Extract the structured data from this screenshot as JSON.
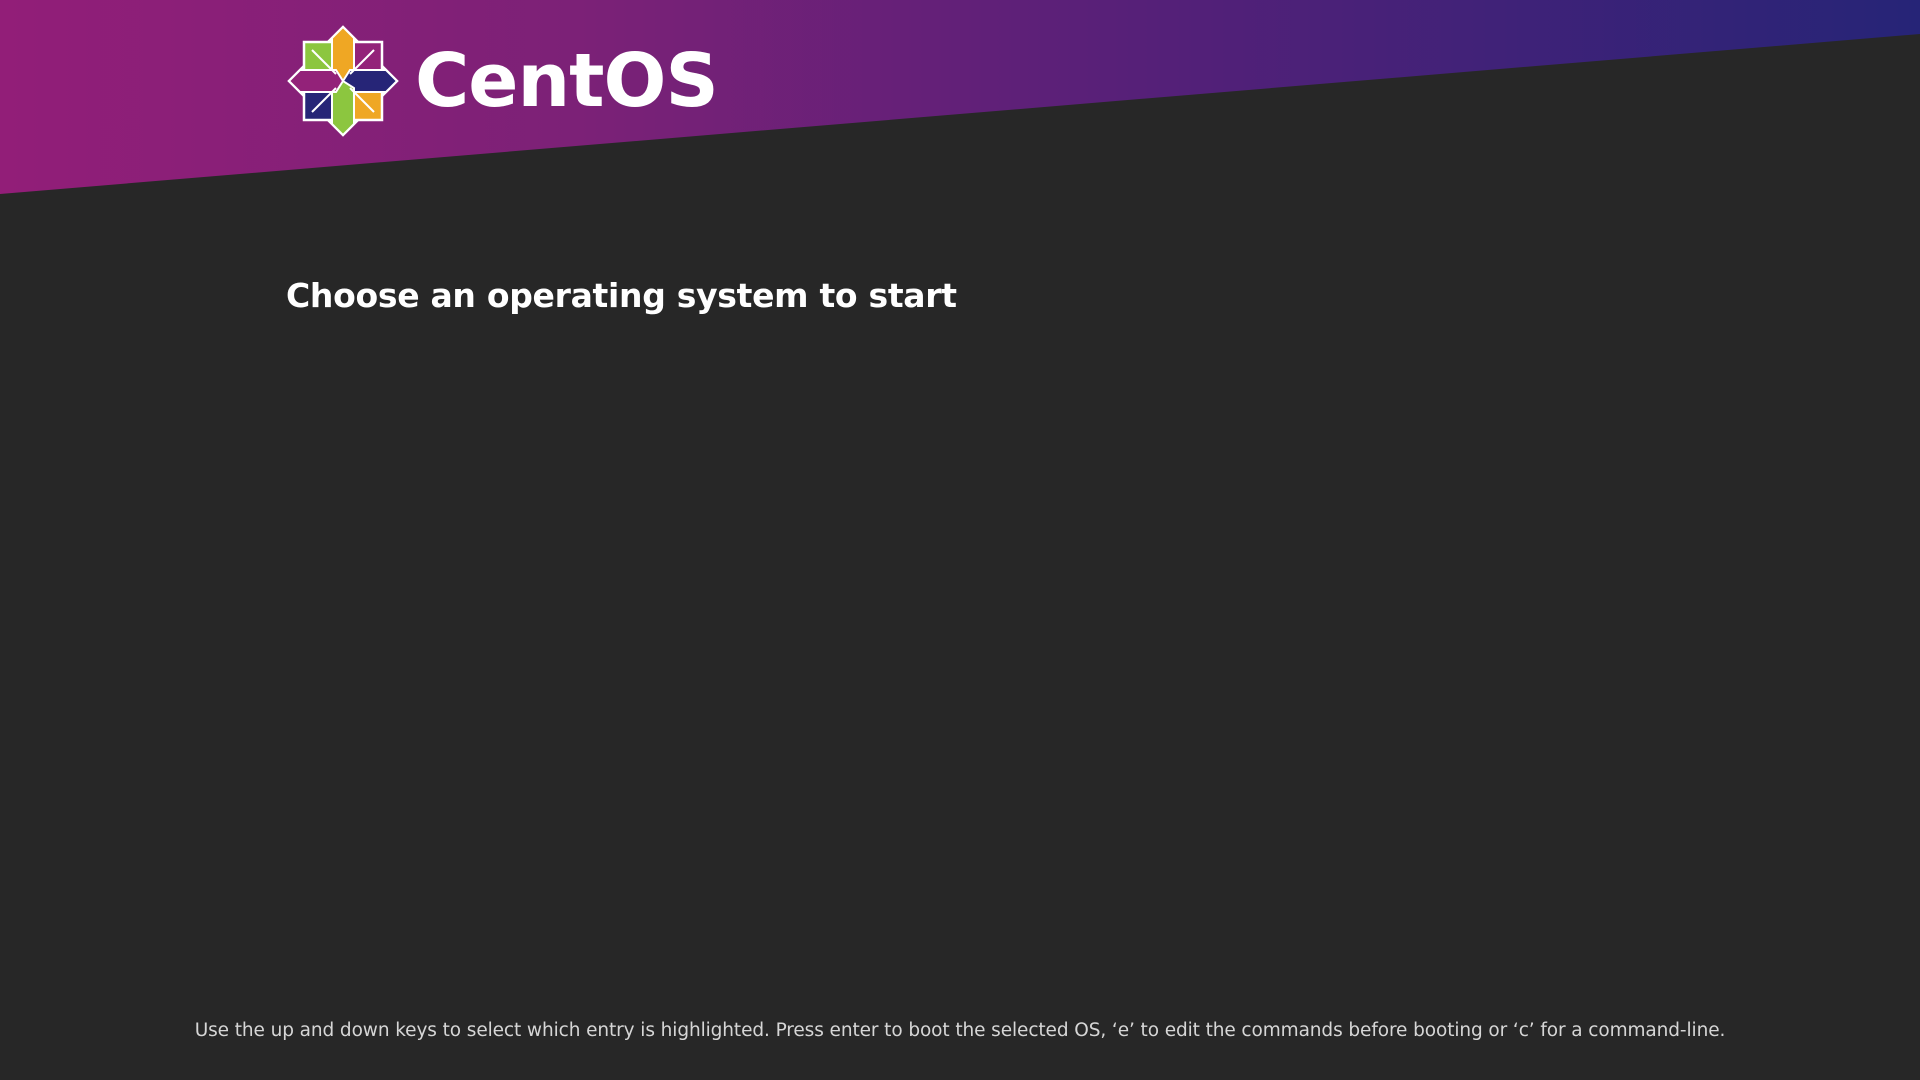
{
  "header": {
    "logo_icon": "centos-logo-icon",
    "brand_name": "CentOS",
    "gradient_start": "#921e78",
    "gradient_end": "#262477"
  },
  "menu": {
    "title": "Choose an operating system to start",
    "entries": []
  },
  "footer": {
    "help_text": "Use the up and down keys to select which entry is highlighted. Press enter to boot the selected OS, ‘e’ to edit the commands before booting or ‘c’ for a command-line."
  },
  "colors": {
    "background": "#272727",
    "text_primary": "#ffffff",
    "text_secondary": "#d6d6d6",
    "logo_green": "#8cc63f",
    "logo_orange": "#efa724",
    "logo_purple": "#932279",
    "logo_navy": "#262577"
  }
}
